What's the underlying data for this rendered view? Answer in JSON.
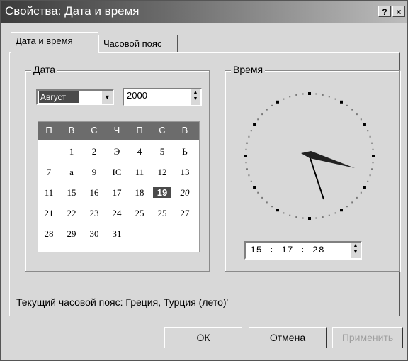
{
  "window": {
    "title": "Свойства: Дата и время",
    "help_label": "?",
    "close_label": "×"
  },
  "tabs": [
    {
      "label": "Дата и время",
      "active": true
    },
    {
      "label": "Часовой пояс",
      "active": false
    }
  ],
  "date_group": {
    "legend": "Дата",
    "month": "Август",
    "year": "2000",
    "weekdays": [
      "П",
      "В",
      "С",
      "Ч",
      "П",
      "С",
      "В"
    ],
    "weeks": [
      [
        "",
        "1",
        "2",
        "Э",
        "4",
        "5",
        "Ь"
      ],
      [
        "7",
        "а",
        "9",
        "IC",
        "11",
        "12",
        "13"
      ],
      [
        "11",
        "15",
        "16",
        "17",
        "18",
        "19",
        "20"
      ],
      [
        "21",
        "22",
        "23",
        "24",
        "25",
        "25",
        "27"
      ],
      [
        "28",
        "29",
        "30",
        "31",
        "",
        "",
        ""
      ]
    ],
    "selected_day": "19"
  },
  "time_group": {
    "legend": "Время",
    "time": "15 : 17 : 28"
  },
  "timezone_text": "Текущий часовой пояс: Греция, Турция (лето)'",
  "buttons": {
    "ok": "ОК",
    "cancel": "Отмена",
    "apply": "Применить"
  },
  "colors": {
    "title_dark": "#3c3c3c",
    "selection": "#4a4a4a",
    "header": "#6c6c6c",
    "face": "#d8d8d8"
  }
}
